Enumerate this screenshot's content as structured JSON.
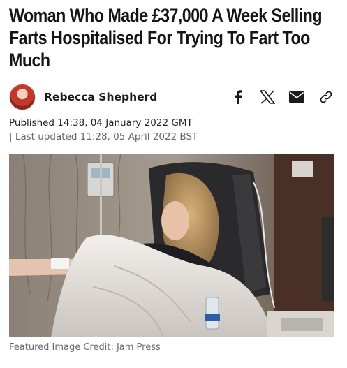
{
  "article": {
    "headline": "Woman Who Made £37,000 A Week Selling Farts Hospitalised For Trying To Fart Too Much",
    "author": {
      "name": "Rebecca Shepherd"
    },
    "share": {
      "facebook": "f",
      "x": "X",
      "email": "email",
      "link": "link"
    },
    "published": "Published 14:38, 04 January 2022 GMT",
    "updated": "| Last updated 11:28, 05 April 2022 BST",
    "image": {
      "caption": "Featured Image Credit: Jam Press"
    }
  },
  "colors": {
    "text": "#1a1a1a",
    "muted": "#666666"
  },
  "icons": [
    "facebook-icon",
    "x-icon",
    "email-icon",
    "link-icon"
  ]
}
